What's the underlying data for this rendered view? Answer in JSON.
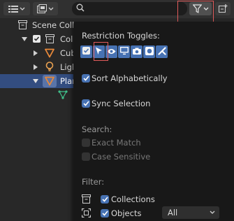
{
  "header": {
    "search": {
      "value": "",
      "placeholder": ""
    },
    "display_mode_icon": "list-view-icon",
    "filter_icon": "funnel-icon",
    "new_collection_icon": "new-collection-icon"
  },
  "tree": [
    {
      "label": "Scene Colle",
      "icon": "scene-collection-icon"
    },
    {
      "label": "Colle",
      "icon": "collection-icon",
      "expanded": true,
      "checked": true
    },
    {
      "label": "Cub",
      "icon": "mesh-object-icon"
    },
    {
      "label": "Ligh",
      "icon": "light-object-icon"
    },
    {
      "label": "Plan",
      "icon": "mesh-object-icon",
      "selected": true
    },
    {
      "label": "",
      "icon": "mesh-data-icon"
    }
  ],
  "popup": {
    "restriction_title": "Restriction Toggles:",
    "toggles": [
      {
        "name": "checkbox-toggle",
        "icon": "checkbox-icon"
      },
      {
        "name": "selectable-toggle",
        "icon": "cursor-arrow-icon"
      },
      {
        "name": "viewport-visibility-toggle",
        "icon": "eye-icon"
      },
      {
        "name": "viewport-disable-toggle",
        "icon": "monitor-icon"
      },
      {
        "name": "render-toggle",
        "icon": "camera-icon"
      },
      {
        "name": "holdout-toggle",
        "icon": "holdout-icon"
      },
      {
        "name": "indirect-only-toggle",
        "icon": "indirect-icon"
      }
    ],
    "sort_alphabetically": {
      "label": "Sort Alphabetically",
      "checked": true
    },
    "sync_selection": {
      "label": "Sync Selection",
      "checked": true
    },
    "search_title": "Search:",
    "exact_match": {
      "label": "Exact Match",
      "checked": false
    },
    "case_sensitive": {
      "label": "Case Sensitive",
      "checked": false
    },
    "filter_title": "Filter:",
    "collections": {
      "label": "Collections",
      "checked": true
    },
    "objects": {
      "label": "Objects",
      "checked": true,
      "select_value": "All"
    }
  },
  "colors": {
    "accent": "#4772b3",
    "selected_row": "#334d80",
    "highlight_box": "#e05a5a",
    "mesh_icon": "#e8893a",
    "mesh_data_icon": "#3fbf8a"
  }
}
